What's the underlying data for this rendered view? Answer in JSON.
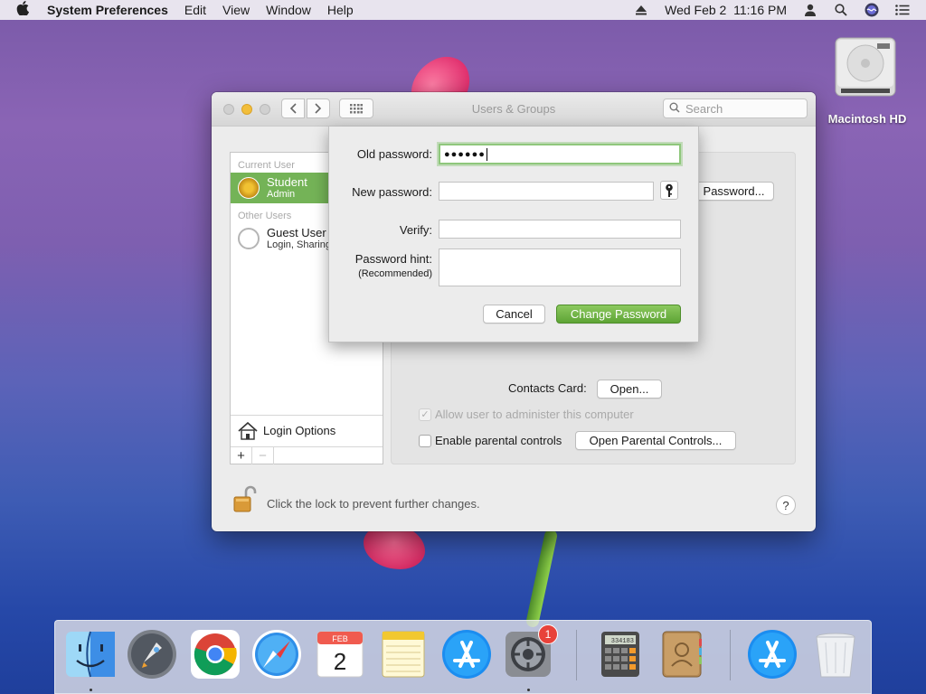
{
  "menubar": {
    "app_name": "System Preferences",
    "items": [
      "Edit",
      "View",
      "Window",
      "Help"
    ],
    "clock": "Wed Feb 2  11:16 PM"
  },
  "desktop": {
    "hd_label": "Macintosh HD"
  },
  "window": {
    "title": "Users & Groups",
    "search_placeholder": "Search",
    "sidebar": {
      "current_user_label": "Current User",
      "current_user": {
        "name": "Student",
        "role": "Admin"
      },
      "other_users_label": "Other Users",
      "other_user": {
        "name": "Guest User",
        "detail": "Login, Sharing"
      },
      "login_options": "Login Options",
      "add": "+",
      "remove": "−"
    },
    "panel": {
      "password_button": "Password...",
      "contacts_label": "Contacts Card:",
      "open_button": "Open...",
      "admin_checkbox": "Allow user to administer this computer",
      "admin_checked": true,
      "parental_checkbox": "Enable parental controls",
      "parental_checked": false,
      "parental_button": "Open Parental Controls..."
    },
    "lock_text": "Click the lock to prevent further changes.",
    "help": "?"
  },
  "sheet": {
    "old_password_label": "Old password:",
    "old_password_value": "●●●●●●",
    "new_password_label": "New password:",
    "new_password_value": "",
    "verify_label": "Verify:",
    "verify_value": "",
    "hint_label": "Password hint:",
    "hint_sub": "(Recommended)",
    "hint_value": "",
    "cancel": "Cancel",
    "change": "Change Password"
  },
  "dock": {
    "calendar_month": "FEB",
    "calendar_day": "2",
    "sysprefs_badge": "1",
    "calculator_display": "334183"
  }
}
